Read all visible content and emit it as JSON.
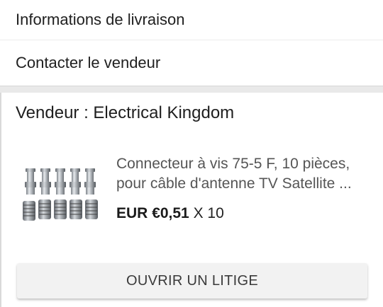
{
  "menu": {
    "shipping_info_label": "Informations de livraison",
    "contact_seller_label": "Contacter le vendeur"
  },
  "seller": {
    "heading": "Vendeur : Electrical Kingdom"
  },
  "product": {
    "title_line1": "Connecteur à vis 75-5 F, 10 pièces,",
    "title_line2": "pour câble d'antenne TV Satellite ...",
    "currency": "EUR",
    "price": "€0,51",
    "quantity": "X 10",
    "image_icon": "f-connector-product-image"
  },
  "actions": {
    "open_dispute_label": "OUVRIR UN LITIGE"
  },
  "colors": {
    "background": "#ffffff",
    "separator": "#e9e9e9",
    "button_bg": "#f2f2f2"
  }
}
